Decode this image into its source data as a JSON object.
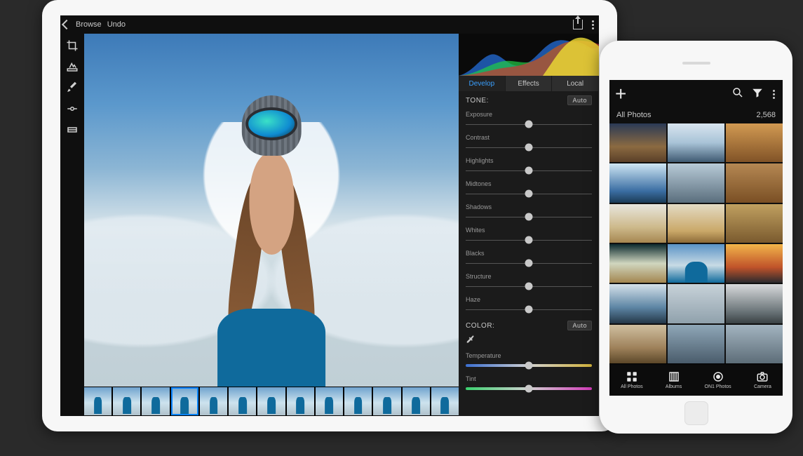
{
  "tablet": {
    "topbar": {
      "back_label": "Browse",
      "undo_label": "Undo"
    },
    "tools": [
      "crop",
      "heal",
      "brush",
      "gradient",
      "tone-curve"
    ],
    "filmstrip_count": 13,
    "filmstrip_selected": 3,
    "panel": {
      "tabs": {
        "develop": "Develop",
        "effects": "Effects",
        "local": "Local"
      },
      "active_tab": "develop",
      "tone_header": "TONE:",
      "color_header": "COLOR:",
      "auto_label": "Auto",
      "tone_sliders": [
        {
          "label": "Exposure",
          "value": 50
        },
        {
          "label": "Contrast",
          "value": 50
        },
        {
          "label": "Highlights",
          "value": 50
        },
        {
          "label": "Midtones",
          "value": 50
        },
        {
          "label": "Shadows",
          "value": 50
        },
        {
          "label": "Whites",
          "value": 50
        },
        {
          "label": "Blacks",
          "value": 50
        },
        {
          "label": "Structure",
          "value": 50
        },
        {
          "label": "Haze",
          "value": 50
        }
      ],
      "color_sliders": [
        {
          "label": "Temperature",
          "value": 50,
          "gradient": "temp"
        },
        {
          "label": "Tint",
          "value": 50,
          "gradient": "tint"
        }
      ]
    }
  },
  "phone": {
    "header": {
      "title": "All Photos",
      "count": "2,568"
    },
    "tabbar": [
      {
        "key": "all",
        "label": "All Photos"
      },
      {
        "key": "albums",
        "label": "Albums"
      },
      {
        "key": "cloud",
        "label": "ON1 Photos"
      },
      {
        "key": "camera",
        "label": "Camera"
      }
    ]
  }
}
